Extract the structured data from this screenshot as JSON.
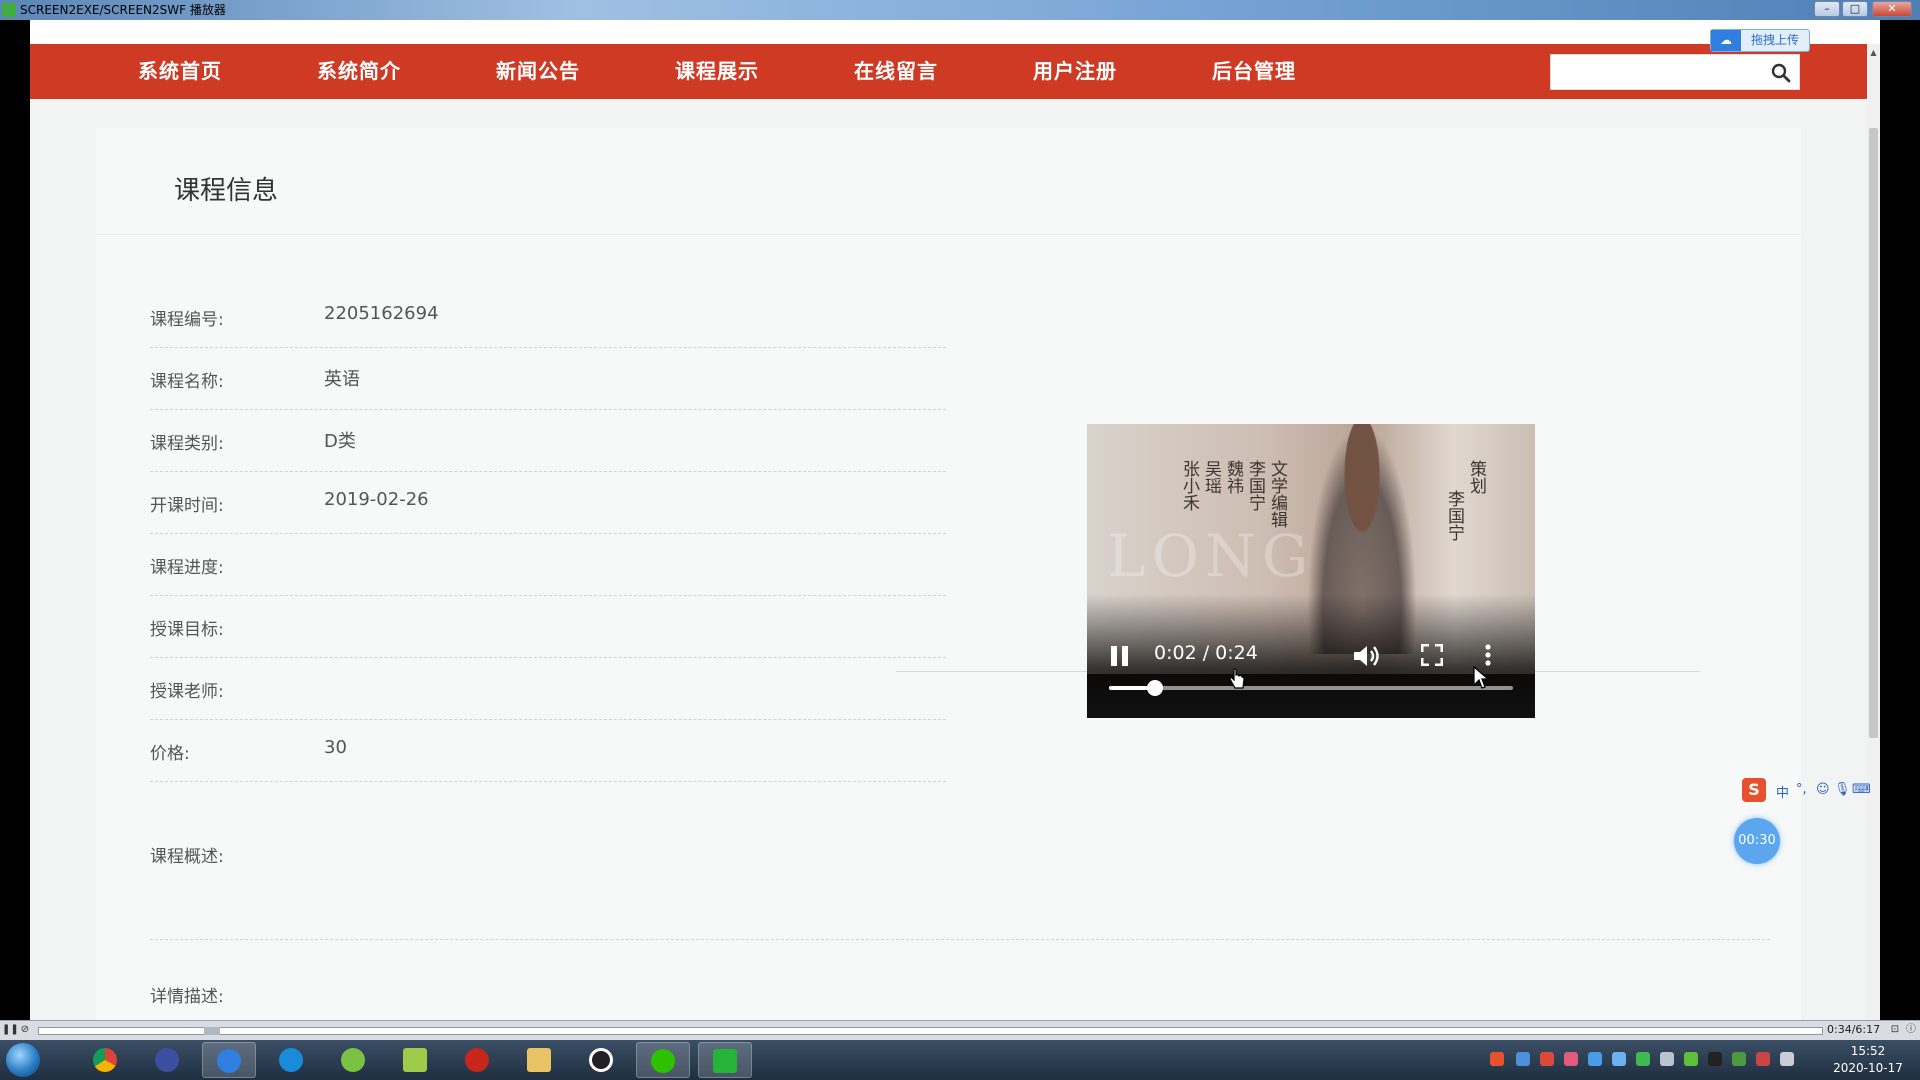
{
  "window": {
    "title": "SCREEN2EXE/SCREEN2SWF 播放器",
    "min": "–",
    "max": "□",
    "close": "✕"
  },
  "upload": {
    "label": "拖拽上传"
  },
  "nav": {
    "items": [
      "系统首页",
      "系统简介",
      "新闻公告",
      "课程展示",
      "在线留言",
      "用户注册",
      "后台管理"
    ],
    "search_placeholder": ""
  },
  "page": {
    "title": "课程信息",
    "fields": [
      {
        "label": "课程编号:",
        "value": "2205162694"
      },
      {
        "label": "课程名称:",
        "value": "英语"
      },
      {
        "label": "课程类别:",
        "value": "D类"
      },
      {
        "label": "开课时间:",
        "value": "2019-02-26"
      },
      {
        "label": "课程进度:",
        "value": ""
      },
      {
        "label": "授课目标:",
        "value": ""
      },
      {
        "label": "授课老师:",
        "value": ""
      },
      {
        "label": "价格:",
        "value": "30"
      }
    ],
    "overview_label": "课程概述:",
    "detail_label": "详情描述:"
  },
  "video": {
    "time": "0:02 / 0:24",
    "progress": 0.115,
    "captions": [
      "文学编辑",
      "李国宁",
      "魏祎",
      "吴瑶",
      "张小禾",
      "策划",
      "李国宁"
    ],
    "watermark": "LONG"
  },
  "overlay": {
    "timer": "00:30",
    "ime": [
      "中",
      "°,",
      "☺",
      "🎙",
      "⌨",
      "♨",
      "👕",
      "▦"
    ]
  },
  "player": {
    "time": "0:34/6:17"
  },
  "clock": {
    "time": "15:52",
    "date": "2020-10-17"
  },
  "colors": {
    "nav": "#cf3a25",
    "accent": "#5ba6ef"
  }
}
